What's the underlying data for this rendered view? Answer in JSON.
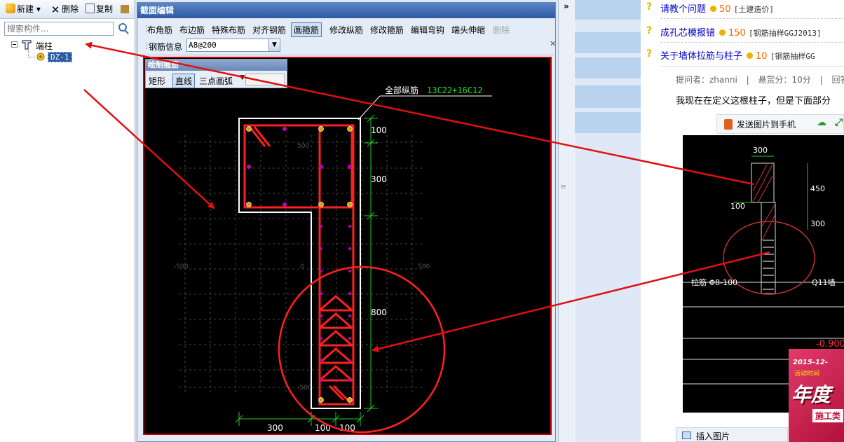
{
  "toolbar": {
    "new_label": "新建",
    "delete_label": "删除",
    "copy_label": "复制"
  },
  "search": {
    "placeholder": "搜索构件..."
  },
  "tree": {
    "root_label": "端柱",
    "child_label": "DZ-1"
  },
  "dialog": {
    "title": "截面编辑",
    "toolbar_items": [
      "布角筋",
      "布边筋",
      "特殊布筋",
      "对齐钢筋",
      "画箍筋",
      "修改纵筋",
      "修改箍筋",
      "编辑弯钩",
      "端头伸缩",
      "删除"
    ],
    "active_item": "画箍筋",
    "disabled_item": "删除",
    "rebar_info_label": "钢筋信息",
    "rebar_info_value": "A8@200",
    "draw_panel": {
      "title": "绘制箍筋",
      "mode_rect": "矩形",
      "mode_line": "直线",
      "mode_arc": "三点画弧"
    }
  },
  "cad": {
    "all_long_rebar_label": "全部纵筋",
    "all_long_rebar_value": "13C22+16C12",
    "dims_vertical": [
      "100",
      "300",
      "800"
    ],
    "dims_horizontal": [
      "300",
      "100",
      "100"
    ],
    "grid_labels": [
      "500",
      "-500",
      "0",
      "500",
      "-500"
    ]
  },
  "right": {
    "questions": [
      {
        "title": "请教个问题",
        "reward": "50",
        "tag": "[土建造价]"
      },
      {
        "title": "成孔芯模报错",
        "reward": "150",
        "tag": "[钢筋抽样GGJ2013]"
      },
      {
        "title": "关于墙体拉筋与柱子",
        "reward": "10",
        "tag": "[钢筋抽样GG"
      }
    ],
    "meta": {
      "asker_label": "提问者：zhanni",
      "score_label": "悬赏分：10分",
      "answer_label": "回答"
    },
    "question_text": "我现在在定义这根柱子，但是下面部分",
    "send_to_phone": "发送图片到手机",
    "insert_image": "插入图片",
    "cad": {
      "d300": "300",
      "d450": "450",
      "d100": "100",
      "d300b": "300",
      "lajin": "拉筋  Φ8-100",
      "wall": "Q11墙",
      "elev": "-0.900"
    },
    "ad": {
      "date": "2015-12-",
      "activity": "活动时间",
      "big": "年度",
      "sub": "施工类"
    }
  },
  "colors": {
    "accent": "#2c5aa3",
    "rebar": "#ff2020",
    "dim": "#22cc22",
    "annotation_arrow": "#e01010"
  }
}
